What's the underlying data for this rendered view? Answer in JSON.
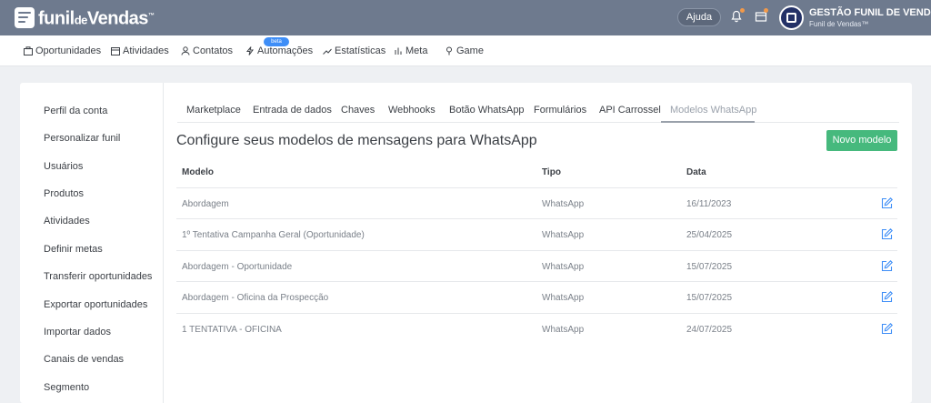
{
  "brand": {
    "name_main": "funil",
    "name_small": "de",
    "name_end": "Vendas",
    "tm": "™"
  },
  "header": {
    "help_label": "Ajuda",
    "user_name": "GESTÃO FUNIL DE VENDAS™",
    "user_company": "Funil de Vendas™",
    "accent": "#233167",
    "notification_color": "#f2994a"
  },
  "nav": {
    "items": [
      {
        "label": "Oportunidades",
        "icon": "briefcase-icon"
      },
      {
        "label": "Atividades",
        "icon": "calendar-icon"
      },
      {
        "label": "Contatos",
        "icon": "contacts-icon"
      },
      {
        "label": "Automações",
        "icon": "bolt-icon",
        "badge": "beta"
      },
      {
        "label": "Estatísticas",
        "icon": "trend-icon"
      },
      {
        "label": "Meta",
        "icon": "bar-chart-icon"
      },
      {
        "label": "Game",
        "icon": "trophy-icon"
      }
    ]
  },
  "sidebar": {
    "items": [
      "Perfil da conta",
      "Personalizar funil",
      "Usuários",
      "Produtos",
      "Atividades",
      "Definir metas",
      "Transferir oportunidades",
      "Exportar oportunidades",
      "Importar dados",
      "Canais de vendas",
      "Segmento"
    ]
  },
  "tabs": {
    "items": [
      "Marketplace",
      "Entrada de dados",
      "Chaves",
      "Webhooks",
      "Botão WhatsApp",
      "Formulários",
      "API Carrossel",
      "Modelos WhatsApp"
    ],
    "active": "Modelos WhatsApp"
  },
  "main": {
    "title": "Configure seus modelos de mensagens para WhatsApp",
    "new_button": "Novo modelo",
    "button_color": "#46b97d",
    "columns": [
      "Modelo",
      "Tipo",
      "Data"
    ],
    "rows": [
      {
        "model": "Abordagem",
        "type": "WhatsApp",
        "date": "16/11/2023"
      },
      {
        "model": "1º Tentativa Campanha Geral (Oportunidade)",
        "type": "WhatsApp",
        "date": "25/04/2025"
      },
      {
        "model": "Abordagem - Oportunidade",
        "type": "WhatsApp",
        "date": "15/07/2025"
      },
      {
        "model": "Abordagem - Oficina da Prospecção",
        "type": "WhatsApp",
        "date": "15/07/2025"
      },
      {
        "model": "1 TENTATIVA - OFICINA",
        "type": "WhatsApp",
        "date": "24/07/2025"
      }
    ]
  }
}
